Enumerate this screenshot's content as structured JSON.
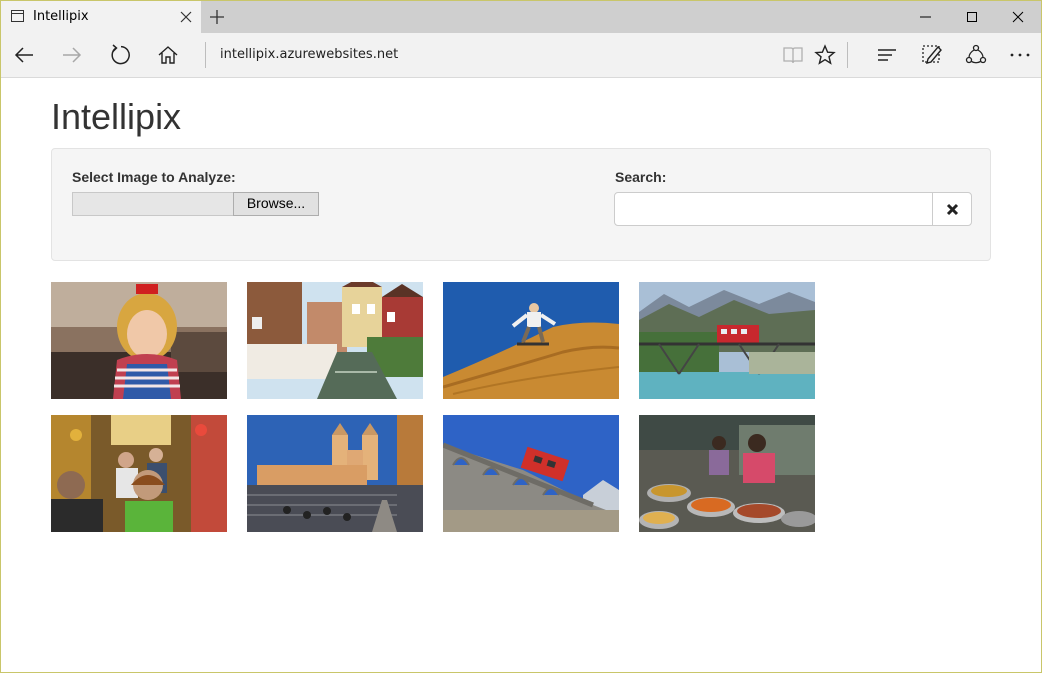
{
  "browser": {
    "tab_title": "Intellipix",
    "address": "intellipix.azurewebsites.net",
    "icons": {
      "tab": "page-icon",
      "close_tab": "close-icon",
      "new_tab": "plus-icon",
      "back": "arrow-left-icon",
      "forward": "arrow-right-icon",
      "refresh": "refresh-icon",
      "home": "home-icon",
      "reading_view": "book-icon",
      "favorite": "star-icon",
      "hub": "hub-icon",
      "notes": "pen-icon",
      "share": "share-icon",
      "more": "more-icon",
      "minimize": "minimize-icon",
      "maximize": "maximize-icon",
      "close_window": "close-icon"
    }
  },
  "page": {
    "title": "Intellipix",
    "upload": {
      "label": "Select Image to Analyze:",
      "browse_label": "Browse..."
    },
    "search": {
      "label": "Search:",
      "value": "",
      "clear_icon": "times-icon"
    },
    "thumbnails": [
      {
        "subject": "girl-in-striped-shirt"
      },
      {
        "subject": "canal-village-houses"
      },
      {
        "subject": "sandboarding-dune"
      },
      {
        "subject": "red-train-on-bridge"
      },
      {
        "subject": "crowded-bazaar"
      },
      {
        "subject": "church-on-steps"
      },
      {
        "subject": "red-train-on-viaduct"
      },
      {
        "subject": "street-food-market"
      }
    ]
  },
  "colors": {
    "tabbar": "#cfcfcf",
    "navbar": "#f2f2f2",
    "well_bg": "#f5f5f5",
    "title_text": "#333333"
  }
}
